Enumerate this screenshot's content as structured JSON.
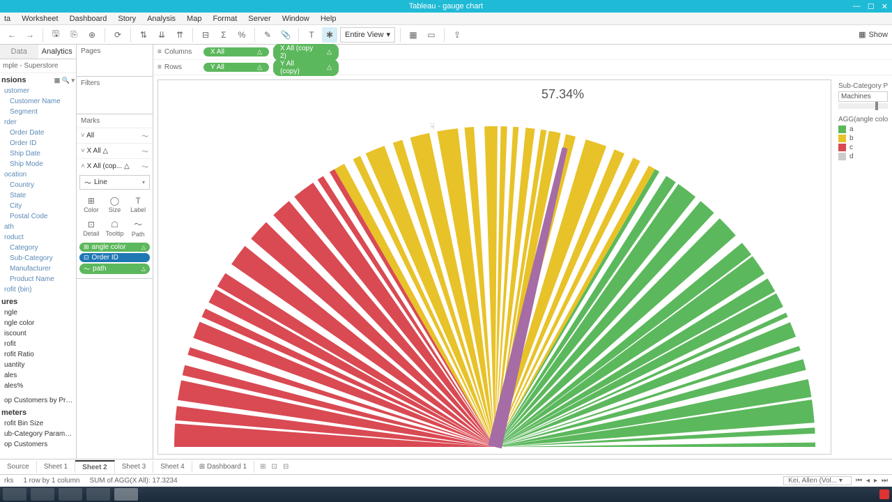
{
  "window": {
    "title": "Tableau - gauge chart"
  },
  "menu": [
    "ta",
    "Worksheet",
    "Dashboard",
    "Story",
    "Analysis",
    "Map",
    "Format",
    "Server",
    "Window",
    "Help"
  ],
  "toolbar": {
    "fit": "Entire View",
    "show": "Show"
  },
  "datapane": {
    "tabs": [
      "Data",
      "Analytics"
    ],
    "source": "mple - Superstore",
    "dim_h": "nsions",
    "dims": [
      "ustomer",
      " Customer Name",
      " Segment",
      "rder",
      " Order Date",
      " Order ID",
      " Ship Date",
      " Ship Mode",
      "ocation",
      " Country",
      " State",
      " City",
      " Postal Code",
      "ath",
      "roduct",
      " Category",
      " Sub-Category",
      " Manufacturer",
      " Product Name",
      "rofit (bin)"
    ],
    "meas_h": "ures",
    "meas": [
      "ngle",
      "ngle color",
      "iscount",
      "rofit",
      "rofit Ratio",
      "uantity",
      "ales",
      "ales%"
    ],
    "sets": [
      "op Customers by Profit"
    ],
    "params_h": "meters",
    "params": [
      "rofit Bin Size",
      "ub-Category Parameter",
      "op Customers"
    ]
  },
  "shelves": {
    "pages": "Pages",
    "filters": "Filters",
    "marks": "Marks",
    "mark_rows": [
      "All",
      "X All",
      "X All (cop..."
    ],
    "mark_type": "Line",
    "cells": [
      "Color",
      "Size",
      "Label",
      "Detail",
      "Tooltip",
      "Path"
    ],
    "pills": [
      {
        "label": "angle color",
        "cls": "green",
        "icon": "⊞"
      },
      {
        "label": "Order ID",
        "cls": "blue",
        "icon": "⊡"
      },
      {
        "label": "path",
        "cls": "green",
        "icon": "～"
      }
    ]
  },
  "rowcol": {
    "columns": "Columns",
    "rows": "Rows",
    "col_pills": [
      "X All",
      "X All (copy 2)"
    ],
    "row_pills": [
      "Y All",
      "Y All (copy)"
    ]
  },
  "chart_data": {
    "type": "pie",
    "title": "",
    "needle_label": "57.34%",
    "needle_angle_deg_from_left": 103.2,
    "segments": [
      {
        "name": "c",
        "color": "#d94a53",
        "span_pct": 33.3
      },
      {
        "name": "b",
        "color": "#e8c229",
        "span_pct": 33.3
      },
      {
        "name": "a",
        "color": "#5cb85c",
        "span_pct": 33.4
      }
    ],
    "legend_title": "AGG(angle color)",
    "legend": [
      {
        "label": "a",
        "color": "#5cb85c"
      },
      {
        "label": "b",
        "color": "#e8c229"
      },
      {
        "label": "c",
        "color": "#d94a53"
      },
      {
        "label": "d",
        "color": "#cccccc"
      }
    ],
    "param_title": "Sub-Category Par",
    "param_value": "Machines"
  },
  "sheets": {
    "source": "Source",
    "tabs": [
      "Sheet 1",
      "Sheet 2",
      "Sheet 3",
      "Sheet 4"
    ],
    "active": "Sheet 2",
    "dash": "Dashboard 1"
  },
  "status": {
    "marks": "rks",
    "rc": "1 row by 1 column",
    "sum": "SUM of AGG(X All): 17.3234",
    "user": "Kei, Allen (Vol..."
  }
}
